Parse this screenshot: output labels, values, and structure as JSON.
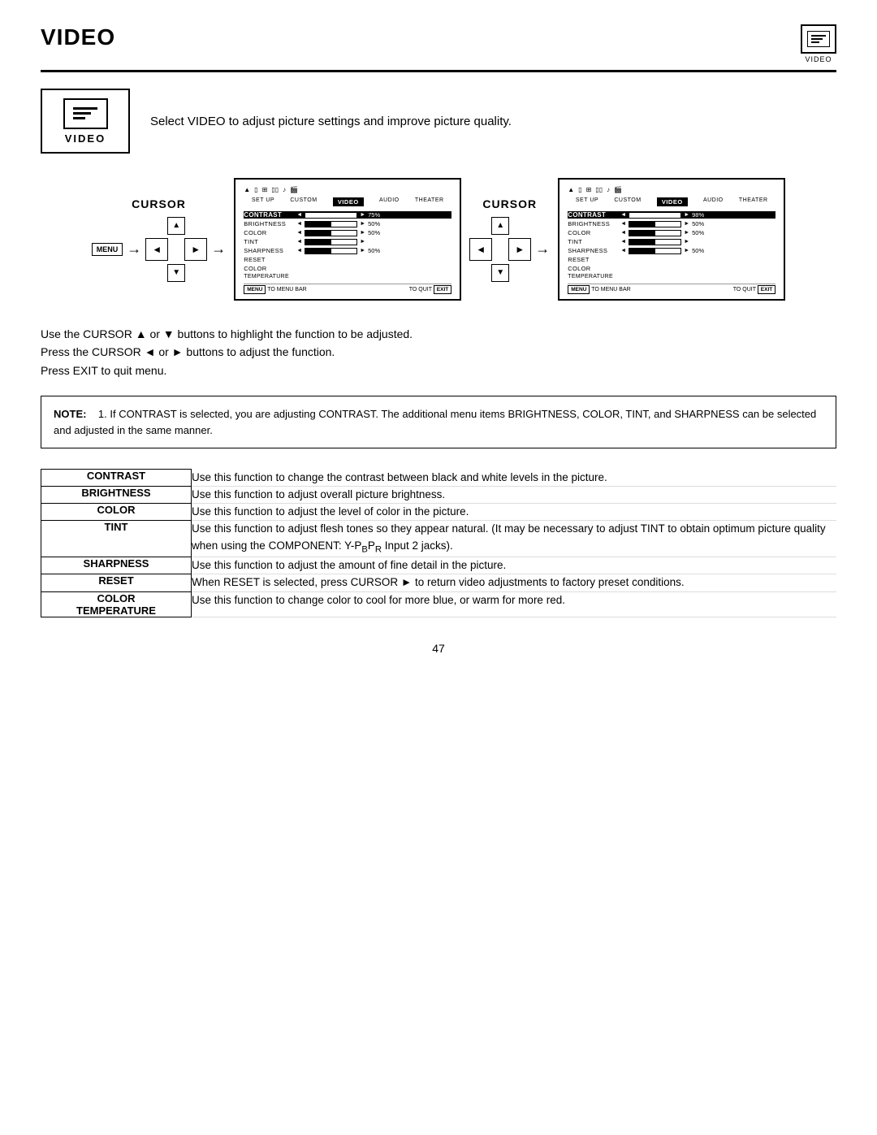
{
  "header": {
    "title": "VIDEO",
    "icon_label": "VIDEO"
  },
  "intro": {
    "video_label": "VIDEO",
    "text": "Select VIDEO to adjust picture settings and improve picture quality."
  },
  "diagram": {
    "cursor_label": "CURSOR",
    "menu_label": "MENU",
    "panel1": {
      "nav_items": [
        "SET UP",
        "CUSTOM",
        "VIDEO",
        "AUDIO",
        "THEATER"
      ],
      "rows": [
        {
          "label": "CONTRAST",
          "bold": true,
          "pct": "75%",
          "fill": 75
        },
        {
          "label": "BRIGHTNESS",
          "bold": false,
          "pct": "50%",
          "fill": 50
        },
        {
          "label": "COLOR",
          "bold": false,
          "pct": "50%",
          "fill": 50
        },
        {
          "label": "TINT",
          "bold": false,
          "pct": "",
          "fill": 50
        },
        {
          "label": "SHARPNESS",
          "bold": false,
          "pct": "50%",
          "fill": 50
        },
        {
          "label": "RESET",
          "bold": false,
          "pct": "",
          "fill": 0
        },
        {
          "label": "COLOR",
          "bold": false,
          "pct": "",
          "fill": 0
        },
        {
          "label": "TEMPERATURE",
          "bold": false,
          "pct": "",
          "fill": 0
        }
      ]
    },
    "panel2": {
      "nav_items": [
        "SET UP",
        "CUSTOM",
        "VIDEO",
        "AUDIO",
        "THEATER"
      ],
      "rows": [
        {
          "label": "CONTRAST",
          "bold": true,
          "pct": "98%",
          "fill": 98
        },
        {
          "label": "BRIGHTNESS",
          "bold": false,
          "pct": "50%",
          "fill": 50
        },
        {
          "label": "COLOR",
          "bold": false,
          "pct": "50%",
          "fill": 50
        },
        {
          "label": "TINT",
          "bold": false,
          "pct": "",
          "fill": 50
        },
        {
          "label": "SHARPNESS",
          "bold": false,
          "pct": "50%",
          "fill": 50
        },
        {
          "label": "RESET",
          "bold": false,
          "pct": "",
          "fill": 0
        },
        {
          "label": "COLOR",
          "bold": false,
          "pct": "",
          "fill": 0
        },
        {
          "label": "TEMPERATURE",
          "bold": false,
          "pct": "",
          "fill": 0
        }
      ]
    }
  },
  "instructions": [
    "Use the CURSOR ▲ or ▼ buttons to highlight the function to be adjusted.",
    "Press the CURSOR ◄ or ► buttons to adjust the function.",
    "Press EXIT to quit menu."
  ],
  "note": {
    "label": "NOTE:",
    "text": "1. If CONTRAST is selected, you are adjusting CONTRAST.  The additional menu items BRIGHTNESS, COLOR, TINT, and SHARPNESS can be selected and adjusted in the same manner."
  },
  "functions": [
    {
      "label": "CONTRAST",
      "desc": "Use this function to change the contrast between black and white levels in the picture."
    },
    {
      "label": "BRIGHTNESS",
      "desc": "Use this function to adjust overall picture brightness."
    },
    {
      "label": "COLOR",
      "desc": "Use this function to adjust the level of color in the picture."
    },
    {
      "label": "TINT",
      "desc": "Use this function to adjust flesh tones so they appear natural. (It may be necessary to adjust TINT to obtain optimum picture quality when using the COMPONENT: Y-PBP R Input 2 jacks)."
    },
    {
      "label": "SHARPNESS",
      "desc": "Use this function to adjust the amount of fine detail in the picture."
    },
    {
      "label": "RESET",
      "desc": "When RESET is selected, press CURSOR ► to return video adjustments to factory preset conditions."
    },
    {
      "label": "COLOR\nTEMPERATURE",
      "desc": "Use this function to change color to cool for more blue, or warm for more red."
    }
  ],
  "page_number": "47"
}
